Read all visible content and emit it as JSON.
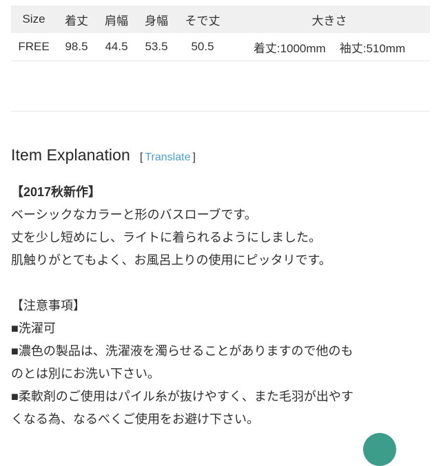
{
  "size_table": {
    "headers": [
      "Size",
      "着丈",
      "肩幅",
      "身幅",
      "そで丈",
      "大きさ"
    ],
    "rows": [
      {
        "size": "FREE",
        "length": "98.5",
        "shoulder": "44.5",
        "chest": "53.5",
        "sleeve": "50.5",
        "big_1": "着丈:1000mm",
        "big_2": "袖丈:510mm"
      }
    ]
  },
  "section": {
    "title": "Item Explanation",
    "bracket_open": "[",
    "translate_label": "Translate",
    "bracket_close": "]"
  },
  "description": {
    "heading": "【2017秋新作】",
    "line_1": "ベーシックなカラーと形のバスローブです。",
    "line_2": "丈を少し短めにし、ライトに着られるようにしました。",
    "line_3": "肌触りがとてもよく、お風呂上りの使用にピッタリです。"
  },
  "notes": {
    "heading": "【注意事項】",
    "line_1": "■洗濯可",
    "line_2": "■濃色の製品は、洗濯液を濁らせることがありますので他のも",
    "line_3": "のとは別にお洗い下さい。",
    "line_4": "■柔軟剤のご使用はパイル糸が抜けやすく、また毛羽が出やす",
    "line_5": "くなる為、なるべくご使用をお避け下さい。"
  },
  "colors": {
    "accent_link": "#4a9fd0",
    "fab": "#3c9d8a",
    "table_header_bg": "#f0f0f0",
    "rule": "#e3e3e3"
  }
}
